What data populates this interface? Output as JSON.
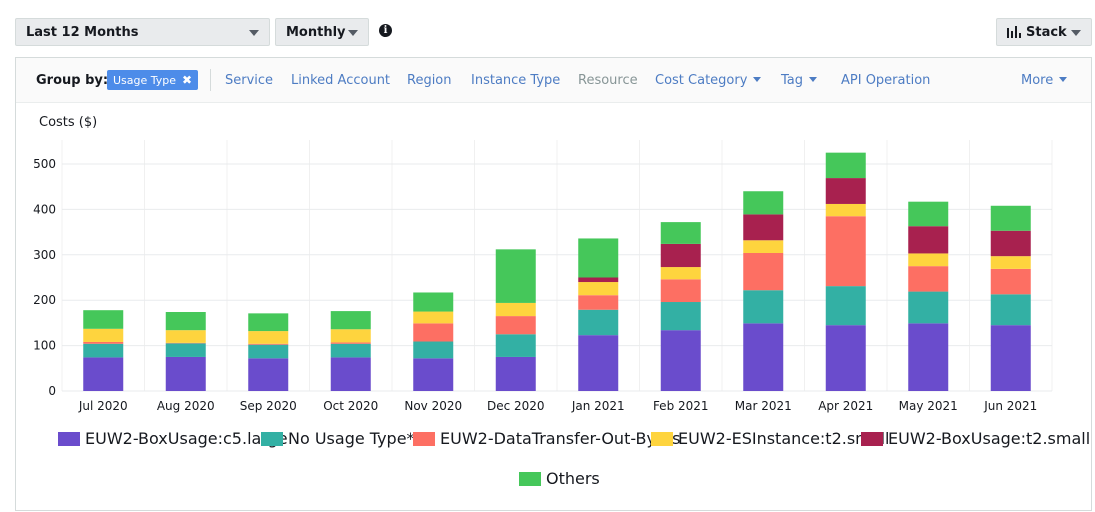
{
  "controls": {
    "time_range": "Last 12 Months",
    "granularity": "Monthly",
    "chart_style": "Stack"
  },
  "group_by": {
    "label": "Group by:",
    "selected": "Usage Type",
    "options": {
      "service": "Service",
      "linked_account": "Linked Account",
      "region": "Region",
      "instance_type": "Instance Type",
      "resource": "Resource",
      "cost_category": "Cost Category",
      "tag": "Tag",
      "api_operation": "API Operation",
      "more": "More"
    }
  },
  "chart_data": {
    "type": "bar",
    "stacked": true,
    "ylabel": "Costs ($)",
    "ylim": [
      0,
      550
    ],
    "yticks": [
      0,
      100,
      200,
      300,
      400,
      500
    ],
    "grid": true,
    "legend_position": "bottom",
    "categories": [
      "Jul 2020",
      "Aug 2020",
      "Sep 2020",
      "Oct 2020",
      "Nov 2020",
      "Dec 2020",
      "Jan 2021",
      "Feb 2021",
      "Mar 2021",
      "Apr 2021",
      "May 2021",
      "Jun 2021"
    ],
    "series": [
      {
        "name": "EUW2-BoxUsage:c5.large",
        "color": "#6a4ccc",
        "values": [
          74,
          75,
          72,
          74,
          72,
          75,
          123,
          134,
          149,
          145,
          149,
          145
        ]
      },
      {
        "name": "No Usage Type***",
        "color": "#33b0a4",
        "values": [
          30,
          30,
          30,
          30,
          37,
          50,
          56,
          62,
          73,
          86,
          70,
          68
        ]
      },
      {
        "name": "EUW2-DataTransfer-Out-Bytes",
        "color": "#fd6f63",
        "values": [
          4,
          1,
          2,
          3,
          40,
          40,
          32,
          50,
          82,
          154,
          56,
          56
        ]
      },
      {
        "name": "EUW2-ESInstance:t2.small",
        "color": "#fed43e",
        "values": [
          29,
          28,
          28,
          29,
          26,
          29,
          29,
          27,
          28,
          27,
          28,
          28
        ]
      },
      {
        "name": "EUW2-BoxUsage:t2.small",
        "color": "#a8214f",
        "values": [
          0,
          0,
          0,
          0,
          0,
          0,
          10,
          51,
          57,
          57,
          60,
          56
        ]
      },
      {
        "name": "Others",
        "color": "#45c75a",
        "values": [
          41,
          40,
          39,
          40,
          42,
          118,
          86,
          48,
          51,
          56,
          54,
          55
        ]
      }
    ]
  }
}
